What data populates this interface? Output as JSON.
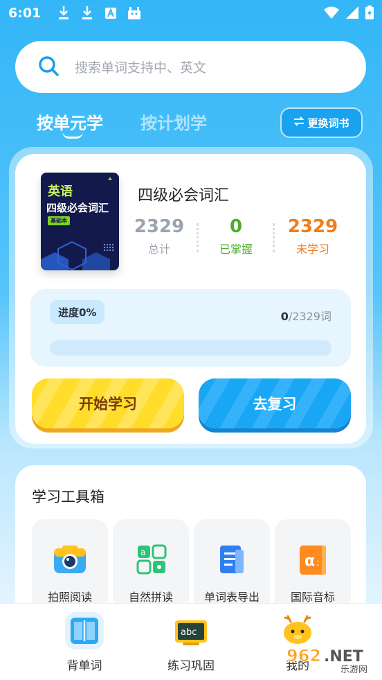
{
  "status_bar": {
    "time": "6:01"
  },
  "search": {
    "placeholder": "搜索单词支持中、英文"
  },
  "tabs": [
    {
      "label": "按单元学",
      "active": true
    },
    {
      "label": "按计划学",
      "active": false
    }
  ],
  "switch_book": {
    "label": "更换词书"
  },
  "book": {
    "cover_lang": "英语",
    "cover_title": "四级必会词汇",
    "cover_tag": "基础本",
    "title": "四级必会词汇"
  },
  "stats": [
    {
      "value": "2329",
      "label": "总计",
      "color": "#9aa4ae"
    },
    {
      "value": "0",
      "label": "已掌握",
      "color": "#4cae2c"
    },
    {
      "value": "2329",
      "label": "未学习",
      "color": "#f07d1a"
    }
  ],
  "progress": {
    "label": "进度0%",
    "fraction": 0,
    "learned": "0",
    "total_text": "/2329词"
  },
  "buttons": {
    "start": "开始学习",
    "review": "去复习"
  },
  "toolbox": {
    "title": "学习工具箱",
    "tools": [
      {
        "label": "拍照阅读",
        "icon": "camera-icon"
      },
      {
        "label": "自然拼读",
        "icon": "phonics-icon"
      },
      {
        "label": "单词表导出",
        "icon": "document-export-icon"
      },
      {
        "label": "国际音标",
        "icon": "phonetic-book-icon"
      }
    ]
  },
  "bottom_nav": [
    {
      "label": "背单词",
      "icon": "book-icon",
      "active": true
    },
    {
      "label": "练习巩固",
      "icon": "blackboard-icon",
      "active": false
    },
    {
      "label": "我的",
      "icon": "mascot-icon",
      "active": false
    }
  ],
  "watermark": {
    "text": "962.NET",
    "subtext": "乐游网"
  },
  "colors": {
    "primary": "#2aa9f5",
    "accent_yellow": "#ffdd2a"
  }
}
